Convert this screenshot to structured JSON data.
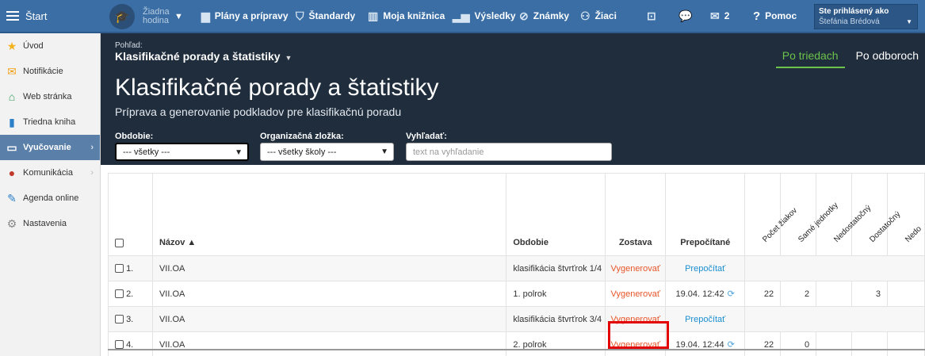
{
  "topbar": {
    "start": "Štart",
    "hodina": "Žiadna hodina",
    "nav": [
      {
        "icon": "briefcase-icon",
        "glyph": "💼",
        "label": "Plány a prípravy"
      },
      {
        "icon": "shield-check-icon",
        "glyph": "🛡",
        "label": "Štandardy"
      },
      {
        "icon": "books-icon",
        "glyph": "📚",
        "label": "Moja knižnica"
      },
      {
        "icon": "bar-chart-icon",
        "glyph": "📊",
        "label": "Výsledky"
      },
      {
        "icon": "grades-icon",
        "glyph": "⊘",
        "label": "Známky"
      },
      {
        "icon": "students-icon",
        "glyph": "🚶",
        "label": "Žiaci"
      }
    ],
    "messages_count": "2",
    "help": "Pomoc",
    "login_label": "Ste prihlásený ako",
    "login_user": "Štefánia Brédová"
  },
  "sidebar": {
    "items": [
      {
        "icon": "star-icon",
        "glyph": "★",
        "color": "#f2b31b",
        "label": "Úvod"
      },
      {
        "icon": "envelope-icon",
        "glyph": "✉",
        "color": "#f2a11b",
        "label": "Notifikácie"
      },
      {
        "icon": "home-icon",
        "glyph": "⌂",
        "color": "#2e9e5b",
        "label": "Web stránka"
      },
      {
        "icon": "book-icon",
        "glyph": "▮",
        "color": "#2a7fc8",
        "label": "Triedna kniha"
      },
      {
        "icon": "open-book-icon",
        "glyph": "📖",
        "color": "#ffffff",
        "label": "Vyučovanie"
      },
      {
        "icon": "chat-icon",
        "glyph": "💬",
        "color": "#c0392b",
        "label": "Komunikácia"
      },
      {
        "icon": "pencil-icon",
        "glyph": "✎",
        "color": "#2a7fc8",
        "label": "Agenda online"
      },
      {
        "icon": "gear-icon",
        "glyph": "⚙",
        "color": "#888888",
        "label": "Nastavenia"
      }
    ]
  },
  "header": {
    "view_label": "Pohľad:",
    "view_value": "Klasifikačné porady a štatistiky",
    "title": "Klasifikačné porady a štatistiky",
    "subtitle": "Príprava a generovanie podkladov pre klasifikačnú poradu",
    "tabs": [
      "Po triedach",
      "Po odboroch"
    ]
  },
  "filters": {
    "obdobie_label": "Obdobie:",
    "obdobie_value": "--- všetky ---",
    "org_label": "Organizačná zložka:",
    "org_value": "--- všetky školy ---",
    "search_label": "Vyhľadať:",
    "search_placeholder": "text na vyhľadanie"
  },
  "table": {
    "headers": {
      "nazov": "Názov ▲",
      "obdobie": "Obdobie",
      "zostava": "Zostava",
      "prepocitane": "Prepočítané"
    },
    "rotated": [
      "Počet žiakov",
      "Samé jednotky",
      "Nedostatočný",
      "Dostatočný",
      "Nedo"
    ],
    "rows": [
      {
        "no": "1.",
        "name": "VII.OA",
        "period": "klasifikácia štvrťrok 1/4",
        "zostava": "Vygenerovať",
        "prep": "Prepočítať",
        "cnt": "",
        "same": "",
        "dost": ""
      },
      {
        "no": "2.",
        "name": "VII.OA",
        "period": "1. polrok",
        "zostava": "Vygenerovať",
        "prep": "19.04. 12:42",
        "cnt": "22",
        "same": "2",
        "dost": "3"
      },
      {
        "no": "3.",
        "name": "VII.OA",
        "period": "klasifikácia štvrťrok 3/4",
        "zostava": "Vygenerovať",
        "prep": "Prepočítať",
        "cnt": "",
        "same": "",
        "dost": ""
      },
      {
        "no": "4.",
        "name": "VII.OA",
        "period": "2. polrok",
        "zostava": "Vygenerovať",
        "prep": "19.04. 12:44",
        "cnt": "22",
        "same": "0",
        "dost": ""
      }
    ]
  }
}
